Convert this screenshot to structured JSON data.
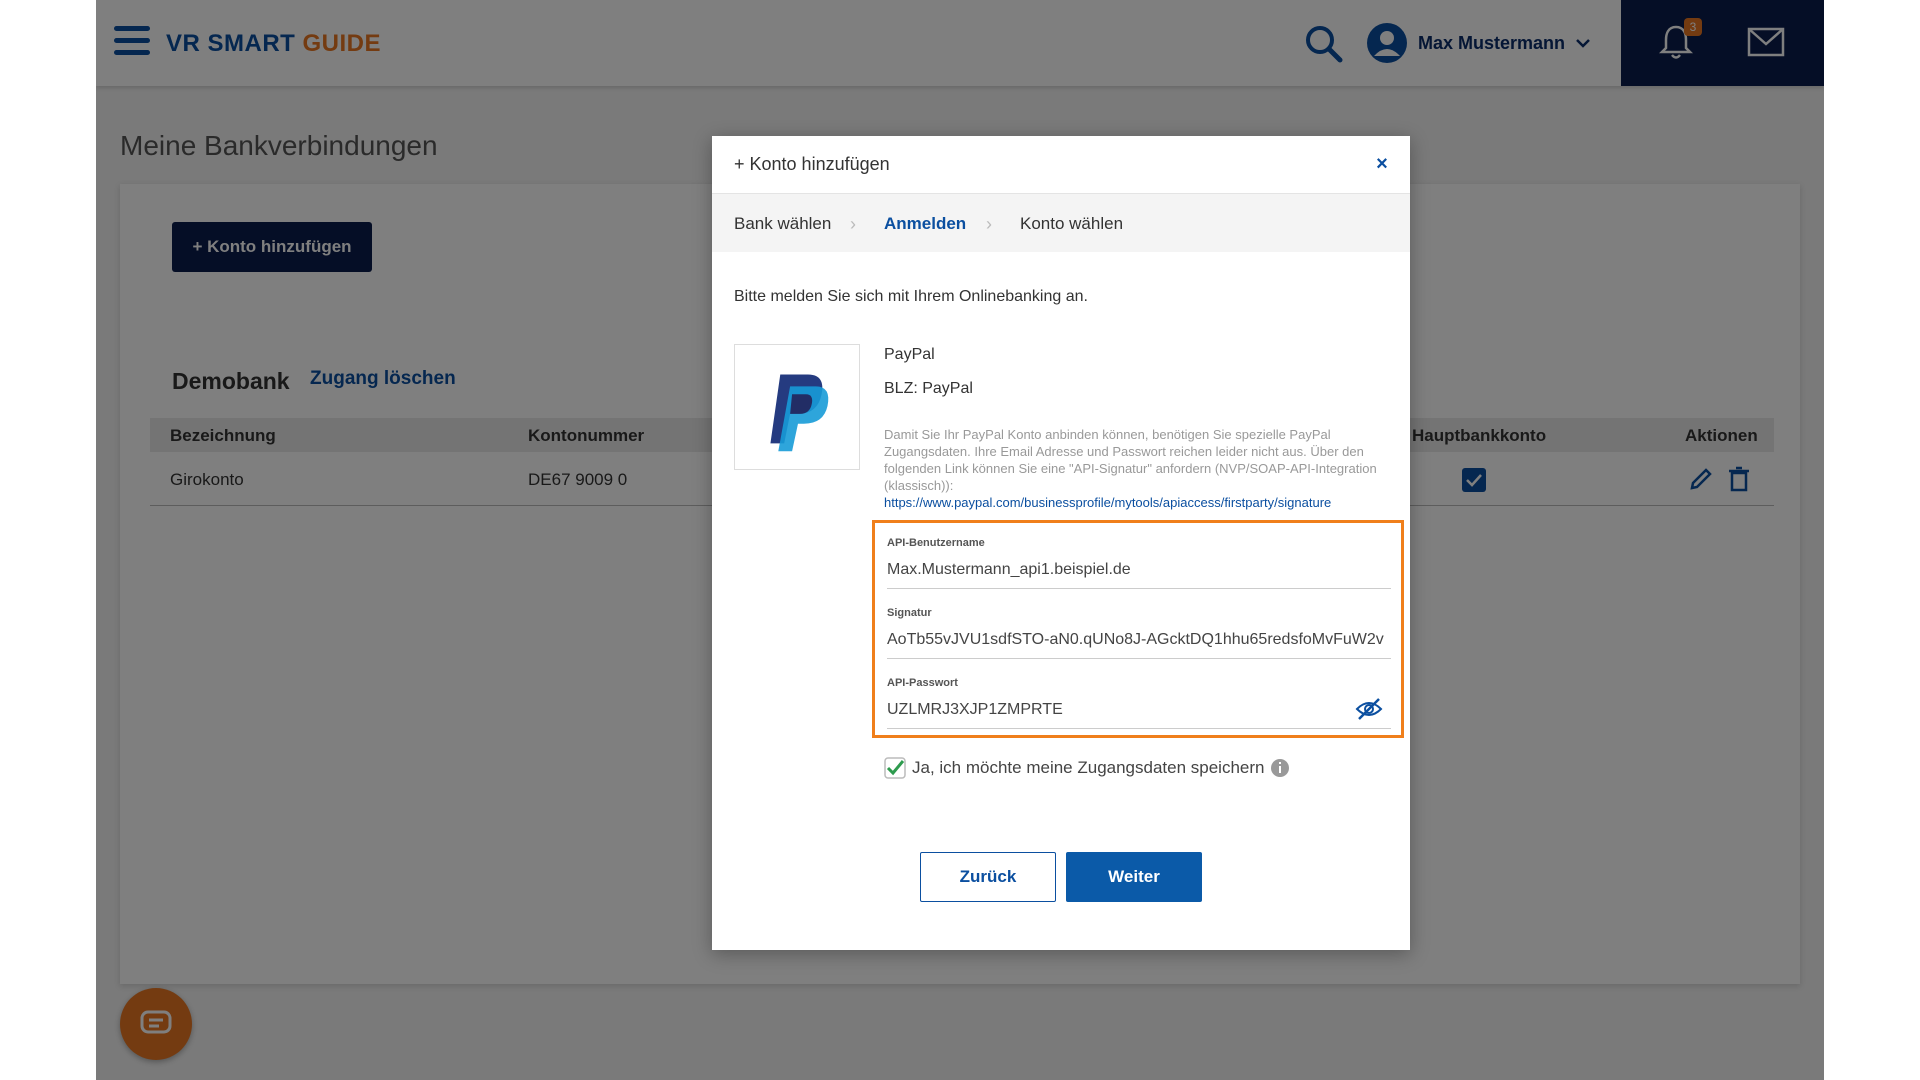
{
  "header": {
    "brand_vr": "VR SMART",
    "brand_guide": "GUIDE",
    "user_name": "Max Mustermann",
    "notification_count": "3"
  },
  "page": {
    "title": "Meine Bankverbindungen",
    "add_button": "+ Konto hinzufügen"
  },
  "bank": {
    "name": "Demobank",
    "delete_link": "Zugang löschen",
    "columns": [
      "Bezeichnung",
      "Kontonummer",
      "Hauptbankkonto",
      "Aktionen"
    ],
    "rows": [
      {
        "bezeichnung": "Girokonto",
        "kontonummer": "DE67 9009 0",
        "hauptbankkonto": true
      }
    ]
  },
  "modal": {
    "title": "+ Konto hinzufügen",
    "close": "×",
    "steps": [
      "Bank wählen",
      "Anmelden",
      "Konto wählen"
    ],
    "active_step": "Anmelden",
    "intro": "Bitte melden Sie sich mit Ihrem Onlinebanking an.",
    "bank_title": "PayPal",
    "bank_blz": "BLZ: PayPal",
    "note_text": "Damit Sie Ihr PayPal Konto anbinden können, benötigen Sie spezielle PayPal Zugangsdaten. Ihre Email Adresse und Passwort reichen leider nicht aus. Über den folgenden Link können Sie eine \"API-Signatur\" anfordern (NVP/SOAP-API-Integration (klassisch)):",
    "note_link": "https://www.paypal.com/businessprofile/mytools/apiaccess/firstparty/signature",
    "fields": {
      "username_label": "API-Benutzername",
      "username_value": "Max.Mustermann_api1.beispiel.de",
      "signature_label": "Signatur",
      "signature_value": "AoTb55vJVU1sdfSTO-aN0.qUNo8J-AGcktDQ1hhu65redsfoMvFuW2v",
      "password_label": "API-Passwort",
      "password_value": "UZLMRJ3XJP1ZMPRTE"
    },
    "save_label": "Ja, ich möchte meine Zugangsdaten speichern",
    "back_button": "Zurück",
    "next_button": "Weiter"
  },
  "colors": {
    "primary": "#0b4fa0",
    "navy": "#0b1d4d",
    "accent": "#e87722",
    "highlight_border": "#f07f1b",
    "check_green": "#2e9b4e"
  },
  "icons": [
    "menu-icon",
    "search-icon",
    "user-avatar-icon",
    "chevron-down-icon",
    "bell-icon",
    "mail-icon",
    "edit-icon",
    "trash-icon",
    "close-icon",
    "paypal-logo",
    "eye-off-icon",
    "checkbox-checked-icon",
    "info-icon",
    "chat-icon"
  ]
}
